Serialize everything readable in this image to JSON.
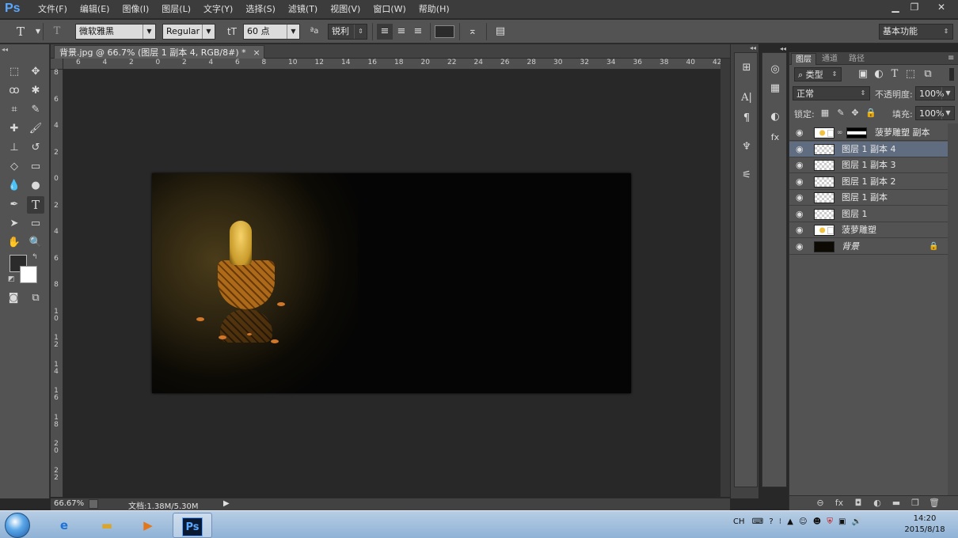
{
  "app": {
    "logo": "Ps",
    "menu": [
      "文件(F)",
      "编辑(E)",
      "图像(I)",
      "图层(L)",
      "文字(Y)",
      "选择(S)",
      "滤镜(T)",
      "视图(V)",
      "窗口(W)",
      "帮助(H)"
    ],
    "window_controls": {
      "minimize": "▁",
      "maximize": "❐",
      "close": "✕"
    }
  },
  "options_bar": {
    "tool_glyph": "T",
    "font_family": "微软雅黑",
    "font_style": "Regular",
    "font_size": "60 点",
    "aa_label": "ªa",
    "anti_alias": "锐利",
    "workspace": "基本功能"
  },
  "document": {
    "tab_title": "背景.jpg @ 66.7% (图层 1 副本 4, RGB/8#) *",
    "tab_close": "×",
    "ruler_h": [
      "6",
      "4",
      "2",
      "0",
      "2",
      "4",
      "6",
      "8",
      "10",
      "12",
      "14",
      "16",
      "18",
      "20",
      "22",
      "24",
      "26",
      "28",
      "30",
      "32",
      "34",
      "36",
      "38",
      "40",
      "42"
    ],
    "ruler_v": [
      "8",
      "6",
      "4",
      "2",
      "0",
      "2",
      "4",
      "6",
      "8",
      "1\n0",
      "1\n2",
      "1\n4",
      "1\n6",
      "1\n8",
      "2\n0",
      "2\n2"
    ]
  },
  "status": {
    "zoom": "66.67%",
    "doc_size": "文档:1.38M/5.30M"
  },
  "panels": {
    "tabs": [
      "图层",
      "通道",
      "路径"
    ],
    "filter_kind": "类型",
    "blend_mode": "正常",
    "opacity_label": "不透明度:",
    "opacity_value": "100%",
    "lock_label": "锁定:",
    "fill_label": "填充:",
    "fill_value": "100%",
    "layers": [
      {
        "name": "菠萝雕塑 副本",
        "selected": false,
        "thumb": "smart",
        "mask": true
      },
      {
        "name": "图层 1 副本 4",
        "selected": true,
        "thumb": "transparent",
        "mask": false
      },
      {
        "name": "图层 1 副本 3",
        "selected": false,
        "thumb": "transparent",
        "mask": false
      },
      {
        "name": "图层 1 副本 2",
        "selected": false,
        "thumb": "transparent",
        "mask": false
      },
      {
        "name": "图层 1 副本",
        "selected": false,
        "thumb": "transparent",
        "mask": false
      },
      {
        "name": "图层 1",
        "selected": false,
        "thumb": "transparent",
        "mask": false
      },
      {
        "name": "菠萝雕塑",
        "selected": false,
        "thumb": "smart",
        "mask": false
      },
      {
        "name": "背景",
        "selected": false,
        "thumb": "dark",
        "mask": false,
        "locked": true
      }
    ],
    "bottom_icons": [
      "link-icon",
      "fx-icon",
      "mask-icon",
      "adjustment-icon",
      "folder-icon",
      "new-layer-icon",
      "trash-icon"
    ]
  },
  "taskbar": {
    "ps_label": "Ps",
    "tray_lang": "CH",
    "time": "14:20",
    "date": "2015/8/18"
  },
  "colors": {
    "foreground": "#2b2b2b",
    "background": "#ffffff",
    "selection": "#606d80",
    "ps_blue": "#5aa8ff"
  }
}
